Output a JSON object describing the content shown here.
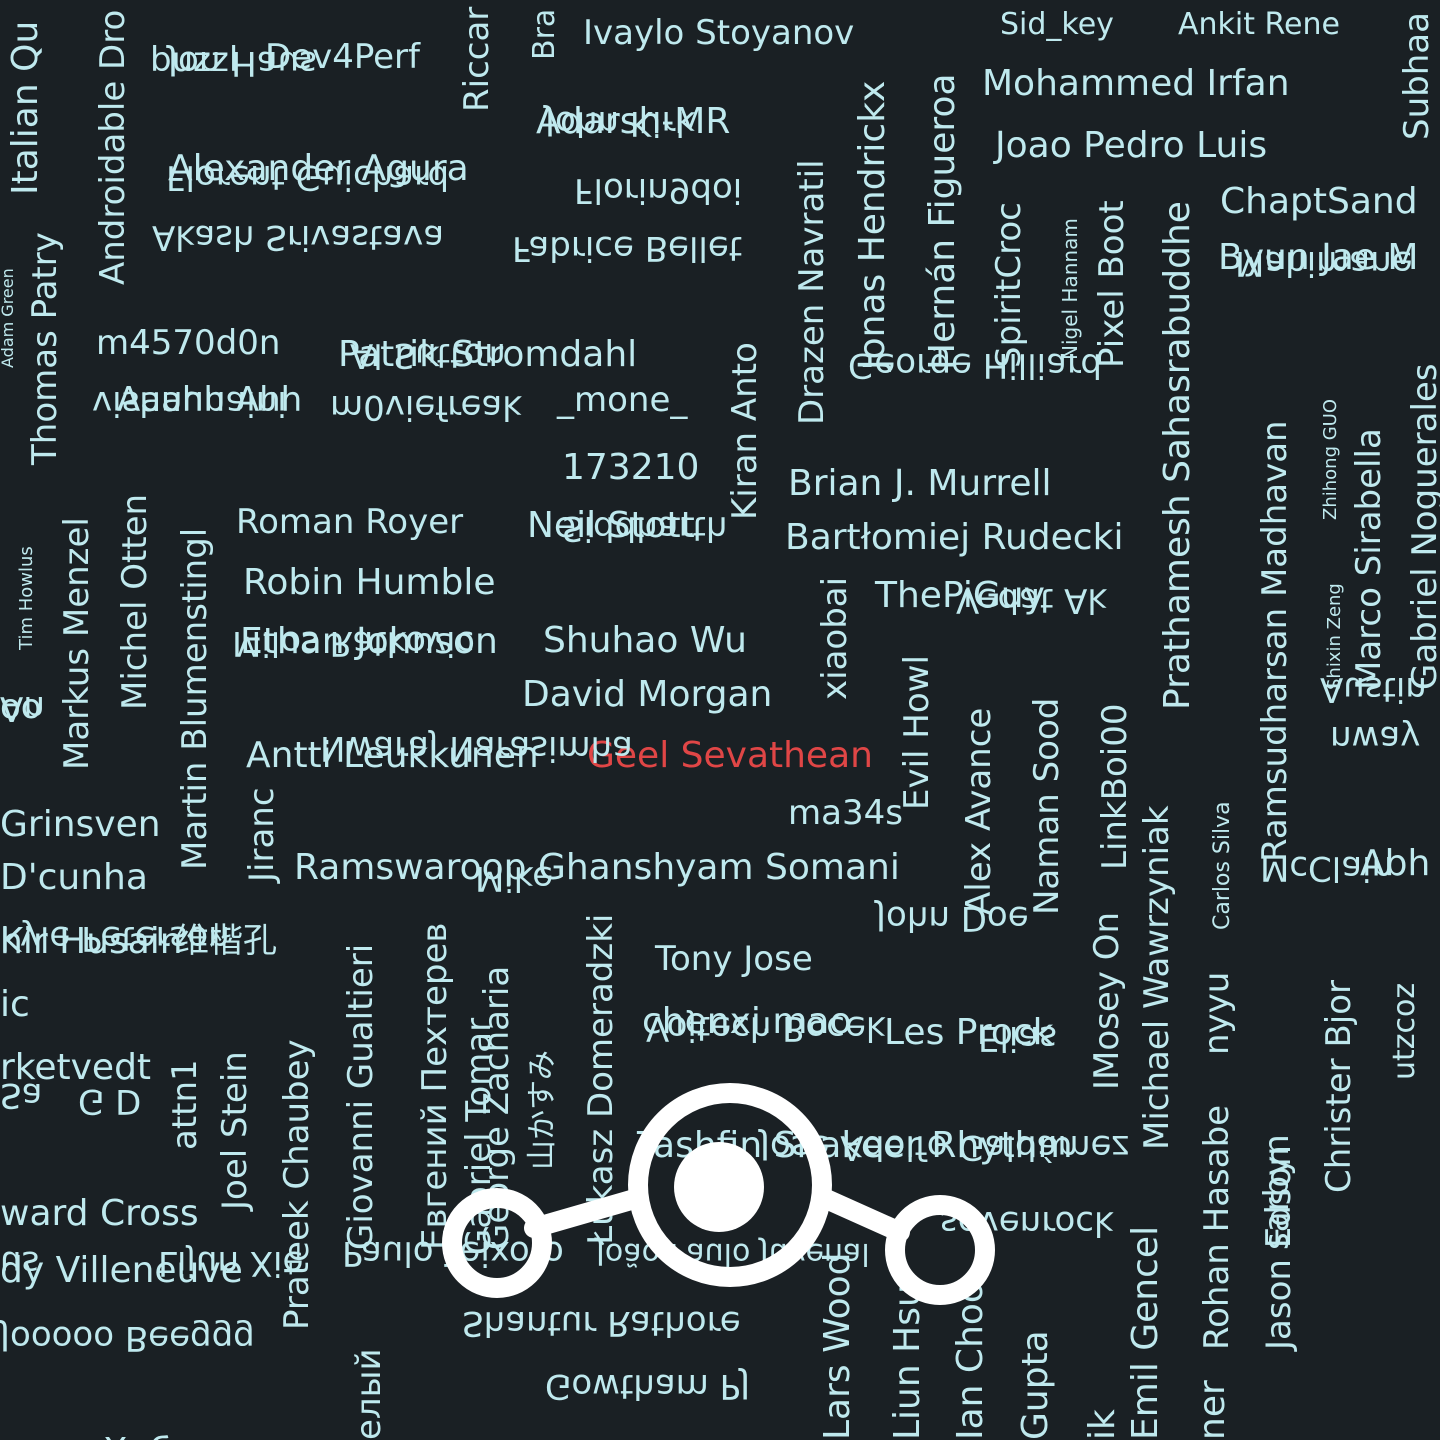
{
  "theme": {
    "background": "#1a2024",
    "text_color": "#bfe9ee",
    "highlight_color": "#e04646",
    "logo_color": "#ffffff"
  },
  "logo_icon": "lineageos-logo-icon",
  "names": [
    {
      "text": "Italian Qu",
      "orient": "up"
    },
    {
      "text": "Androidable Dro",
      "orient": "up"
    },
    {
      "text": "buzzl",
      "orient": "h"
    },
    {
      "text": "Dev4Perf",
      "orient": "h"
    },
    {
      "text": "Riccar",
      "orient": "up"
    },
    {
      "text": "Bra",
      "orient": "up"
    },
    {
      "text": "Ivaylo Stoyanov",
      "orient": "h"
    },
    {
      "text": "Sid_key",
      "orient": "h"
    },
    {
      "text": "Ankit Rene",
      "orient": "h"
    },
    {
      "text": "Subhaa",
      "orient": "up"
    },
    {
      "text": "Mohammed Irfan",
      "orient": "h"
    },
    {
      "text": "Jon Haus",
      "orient": "flip"
    },
    {
      "text": "Adarsh-MR",
      "orient": "h"
    },
    {
      "text": "Drazen Navratil",
      "orient": "up"
    },
    {
      "text": "Jonas Hendrickx",
      "orient": "up"
    },
    {
      "text": "Hernán Figueroa",
      "orient": "up"
    },
    {
      "text": "Joao Pedro Luis",
      "orient": "h"
    },
    {
      "text": "Alexander Agura",
      "orient": "h"
    },
    {
      "text": "John Kirk",
      "orient": "flip"
    },
    {
      "text": "SpiritCroc",
      "orient": "up"
    },
    {
      "text": "Nigel Hannam",
      "orient": "up"
    },
    {
      "text": "Pixel Boot",
      "orient": "up"
    },
    {
      "text": "Prathamesh Sahasrabuddhe",
      "orient": "up"
    },
    {
      "text": "ChaptSand",
      "orient": "h"
    },
    {
      "text": "Florent Guichard",
      "orient": "flip"
    },
    {
      "text": "Florin9doi",
      "orient": "flip"
    },
    {
      "text": "Byun Jae M",
      "orient": "h"
    },
    {
      "text": "Adam Green",
      "orient": "up"
    },
    {
      "text": "Thomas Patry",
      "orient": "up"
    },
    {
      "text": "Akash Srivastava",
      "orient": "flip"
    },
    {
      "text": "Fabrice Bellet",
      "orient": "flip"
    },
    {
      "text": "Mahimane",
      "orient": "flip"
    },
    {
      "text": "m4570d0n",
      "orient": "h"
    },
    {
      "text": "Patrik Stromdahl",
      "orient": "h"
    },
    {
      "text": "Kiran Anto",
      "orient": "up"
    },
    {
      "text": "Aaahh Ahh",
      "orient": "h"
    },
    {
      "text": "Al Sutton",
      "orient": "flip"
    },
    {
      "text": "_mone_",
      "orient": "h"
    },
    {
      "text": "George Hilliard",
      "orient": "flip"
    },
    {
      "text": "Ramsudharsan Madhavan",
      "orient": "up"
    },
    {
      "text": "Zhihong GUO",
      "orient": "up"
    },
    {
      "text": "Marco Sirabella",
      "orient": "up"
    },
    {
      "text": "Gabriel Noguerales",
      "orient": "up"
    },
    {
      "text": "vishnunaini",
      "orient": "flip"
    },
    {
      "text": "m0viefreak",
      "orient": "flip"
    },
    {
      "text": "173210",
      "orient": "h"
    },
    {
      "text": "Brian J. Murrell",
      "orient": "h"
    },
    {
      "text": "Tim Howlus",
      "orient": "up"
    },
    {
      "text": "Markus Menzel",
      "orient": "up"
    },
    {
      "text": "Michel Otten",
      "orient": "up"
    },
    {
      "text": "Roman Royer",
      "orient": "h"
    },
    {
      "text": "Neil Stott",
      "orient": "h"
    },
    {
      "text": "Bartłomiej Rudecki",
      "orient": "h"
    },
    {
      "text": "Martin Blumenstingl",
      "orient": "up"
    },
    {
      "text": "Robin Humble",
      "orient": "h"
    },
    {
      "text": "Siddharth",
      "orient": "flip"
    },
    {
      "text": "ThePiGuy",
      "orient": "h"
    },
    {
      "text": "Shixin Zeng",
      "orient": "up"
    },
    {
      "text": "Ethan Johnson",
      "orient": "h"
    },
    {
      "text": "Shuhao Wu",
      "orient": "h"
    },
    {
      "text": "xiaobai",
      "orient": "up"
    },
    {
      "text": "Vedat Ak",
      "orient": "flip"
    },
    {
      "text": "Evil Howl",
      "orient": "up"
    },
    {
      "text": "Alex Avance",
      "orient": "up"
    },
    {
      "text": "Naman Sood",
      "orient": "up"
    },
    {
      "text": "LinkBoi00",
      "orient": "up"
    },
    {
      "text": "Michael Wawrzyniak",
      "orient": "up"
    },
    {
      "text": "Carlos Silva",
      "orient": "up"
    },
    {
      "text": "Milos Ratkovic",
      "orient": "flip"
    },
    {
      "text": "David Morgan",
      "orient": "h"
    },
    {
      "text": "oo",
      "orient": "h"
    },
    {
      "text": "An",
      "orient": "flip"
    },
    {
      "text": "Antti Leukkunen",
      "orient": "h"
    },
    {
      "text": "Geel Sevathean",
      "orient": "h",
      "highlight": true
    },
    {
      "text": "Austin",
      "orient": "flip"
    },
    {
      "text": "Grinsven",
      "orient": "h"
    },
    {
      "text": "Nwaraj Narasimha",
      "orient": "flip"
    },
    {
      "text": "ma34s",
      "orient": "h"
    },
    {
      "text": "nway",
      "orient": "flip"
    },
    {
      "text": "Jiranc",
      "orient": "up"
    },
    {
      "text": "D'cunha",
      "orient": "h"
    },
    {
      "text": "Ramswaroop Ghanshyam Somani",
      "orient": "h"
    },
    {
      "text": "Abh",
      "orient": "h"
    },
    {
      "text": "hir Husain",
      "orient": "h"
    },
    {
      "text": "维楷孔",
      "orient": "h"
    },
    {
      "text": "Giovanni Gualtieri",
      "orient": "up"
    },
    {
      "text": "Евгений Пехтерев",
      "orient": "up"
    },
    {
      "text": "Mike",
      "orient": "flip"
    },
    {
      "text": "Łukasz Domeradzki",
      "orient": "up"
    },
    {
      "text": "Tony Jose",
      "orient": "h"
    },
    {
      "text": "John Doe",
      "orient": "flip"
    },
    {
      "text": "IMosey On",
      "orient": "up"
    },
    {
      "text": "McClain",
      "orient": "flip"
    },
    {
      "text": "ic",
      "orient": "h"
    },
    {
      "text": "Kyle Peterson",
      "orient": "flip"
    },
    {
      "text": "chenxi.mao",
      "orient": "h"
    },
    {
      "text": "Les Prock",
      "orient": "h"
    },
    {
      "text": "nyyu",
      "orient": "up"
    },
    {
      "text": "sarbyn",
      "orient": "up"
    },
    {
      "text": "Christer Bjor",
      "orient": "up"
    },
    {
      "text": "utzcoz",
      "orient": "up"
    },
    {
      "text": "rketvedt",
      "orient": "h"
    },
    {
      "text": "Prateek Chaubey",
      "orient": "up"
    },
    {
      "text": "George Zacharia",
      "orient": "up"
    },
    {
      "text": "Vojtech Bocek",
      "orient": "flip"
    },
    {
      "text": "Elias",
      "orient": "flip"
    },
    {
      "text": "Rohan Hasabe",
      "orient": "up"
    },
    {
      "text": "Jason Edson",
      "orient": "up"
    },
    {
      "text": "Sa",
      "orient": "flip"
    },
    {
      "text": "G D",
      "orient": "flip"
    },
    {
      "text": "attn1",
      "orient": "up"
    },
    {
      "text": "Joel Stein",
      "orient": "up"
    },
    {
      "text": "山かすみ",
      "orient": "up"
    },
    {
      "text": "Tashfin Shakeer Rhythm",
      "orient": "h"
    },
    {
      "text": "ward Cross",
      "orient": "h"
    },
    {
      "text": "José Adolfo Galdámez",
      "orient": "flip"
    },
    {
      "text": "dy Villeneuve",
      "orient": "h"
    },
    {
      "text": "sevenrock",
      "orient": "flip"
    },
    {
      "text": "Gabriel Tomar",
      "orient": "up"
    },
    {
      "text": "us",
      "orient": "flip"
    },
    {
      "text": "Lijun Xie",
      "orient": "flip"
    },
    {
      "text": "Paulo Teixoto",
      "orient": "flip"
    },
    {
      "text": "João Paulo Juvenal",
      "orient": "flip"
    },
    {
      "text": "Emil Gencel",
      "orient": "up"
    },
    {
      "text": "Jooooo Beeggg",
      "orient": "flip"
    },
    {
      "text": "Shantur Rathore",
      "orient": "flip"
    },
    {
      "text": "Lars Wood",
      "orient": "up"
    },
    {
      "text": "Liun Hsu",
      "orient": "up"
    },
    {
      "text": "Ian Choo",
      "orient": "up"
    },
    {
      "text": "Gupta",
      "orient": "up"
    },
    {
      "text": "ik",
      "orient": "up"
    },
    {
      "text": "ner",
      "orient": "up"
    },
    {
      "text": "нтин Хабарлак",
      "orient": "h"
    },
    {
      "text": "елый",
      "orient": "up"
    },
    {
      "text": "Gowtham PJ",
      "orient": "flip"
    }
  ]
}
